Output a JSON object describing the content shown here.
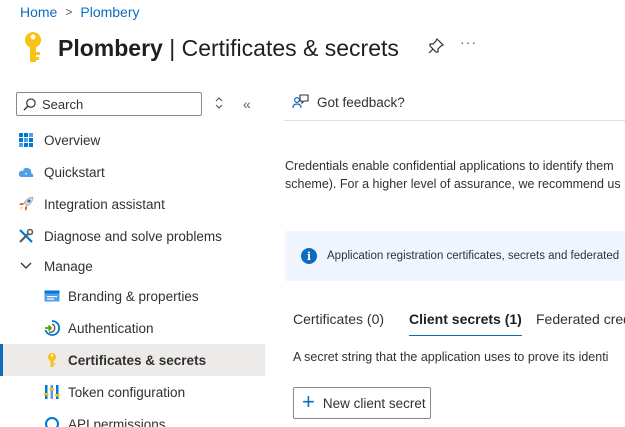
{
  "breadcrumb": {
    "home": "Home",
    "separator": ">",
    "current": "Plombery"
  },
  "header": {
    "resource_name": "Plombery",
    "separator": " | ",
    "page_title": "Certificates & secrets",
    "more_label": "···"
  },
  "sidebar": {
    "search_placeholder": "Search",
    "collapse_label": "«",
    "items": [
      {
        "label": "Overview",
        "icon": "overview-grid-icon"
      },
      {
        "label": "Quickstart",
        "icon": "quickstart-cloud-icon"
      },
      {
        "label": "Integration assistant",
        "icon": "rocket-icon"
      },
      {
        "label": "Diagnose and solve problems",
        "icon": "wrench-icon"
      },
      {
        "label": "Manage",
        "icon": "chevron-down-icon"
      },
      {
        "label": "Branding & properties",
        "icon": "branding-icon"
      },
      {
        "label": "Authentication",
        "icon": "authentication-icon"
      },
      {
        "label": "Certificates & secrets",
        "icon": "key-icon",
        "selected": true
      },
      {
        "label": "Token configuration",
        "icon": "token-icon"
      },
      {
        "label": "API permissions",
        "icon": "api-permissions-icon"
      }
    ]
  },
  "main": {
    "feedback_label": "Got feedback?",
    "description_line1": "Credentials enable confidential applications to identify them",
    "description_line2": "scheme). For a higher level of assurance, we recommend us",
    "info_text": "Application registration certificates, secrets and federated",
    "tabs": [
      {
        "label": "Certificates (0)"
      },
      {
        "label": "Client secrets (1)",
        "active": true
      },
      {
        "label": "Federated cred"
      }
    ],
    "secret_description": "A secret string that the application uses to prove its identi",
    "new_secret_label": "New client secret",
    "new_secret_icon": "+"
  },
  "colors": {
    "accent": "#0f6cbd",
    "key_yellow": "#f8c315",
    "info_bg": "#f0f6ff",
    "selected_bg": "#edebe9"
  }
}
